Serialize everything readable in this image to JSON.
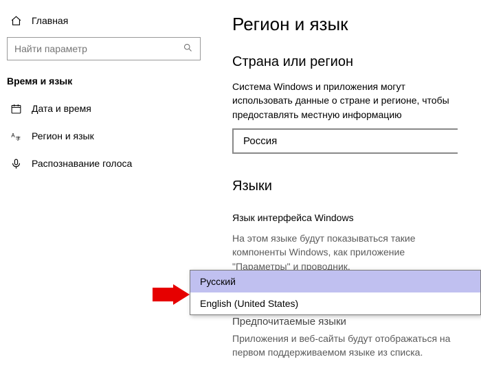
{
  "sidebar": {
    "home_label": "Главная",
    "search_placeholder": "Найти параметр",
    "section_label": "Время и язык",
    "items": [
      {
        "label": "Дата и время"
      },
      {
        "label": "Регион и язык"
      },
      {
        "label": "Распознавание голоса"
      }
    ]
  },
  "main": {
    "title": "Регион и язык",
    "region_heading": "Страна или регион",
    "region_desc": "Система Windows и приложения могут использовать данные о стране и регионе, чтобы предоставлять местную информацию",
    "country_value": "Россия",
    "lang_heading": "Языки",
    "display_lang_label": "Язык интерфейса Windows",
    "display_lang_desc": "На этом языке будут показываться такие компоненты Windows, как приложение \"Параметры\" и проводник.",
    "dropdown": {
      "options": [
        "Русский",
        "English (United States)"
      ]
    },
    "pref_heading_partial": "Предпочитаемые языки",
    "pref_desc": "Приложения и веб-сайты будут отображаться на первом поддерживаемом языке из списка."
  }
}
